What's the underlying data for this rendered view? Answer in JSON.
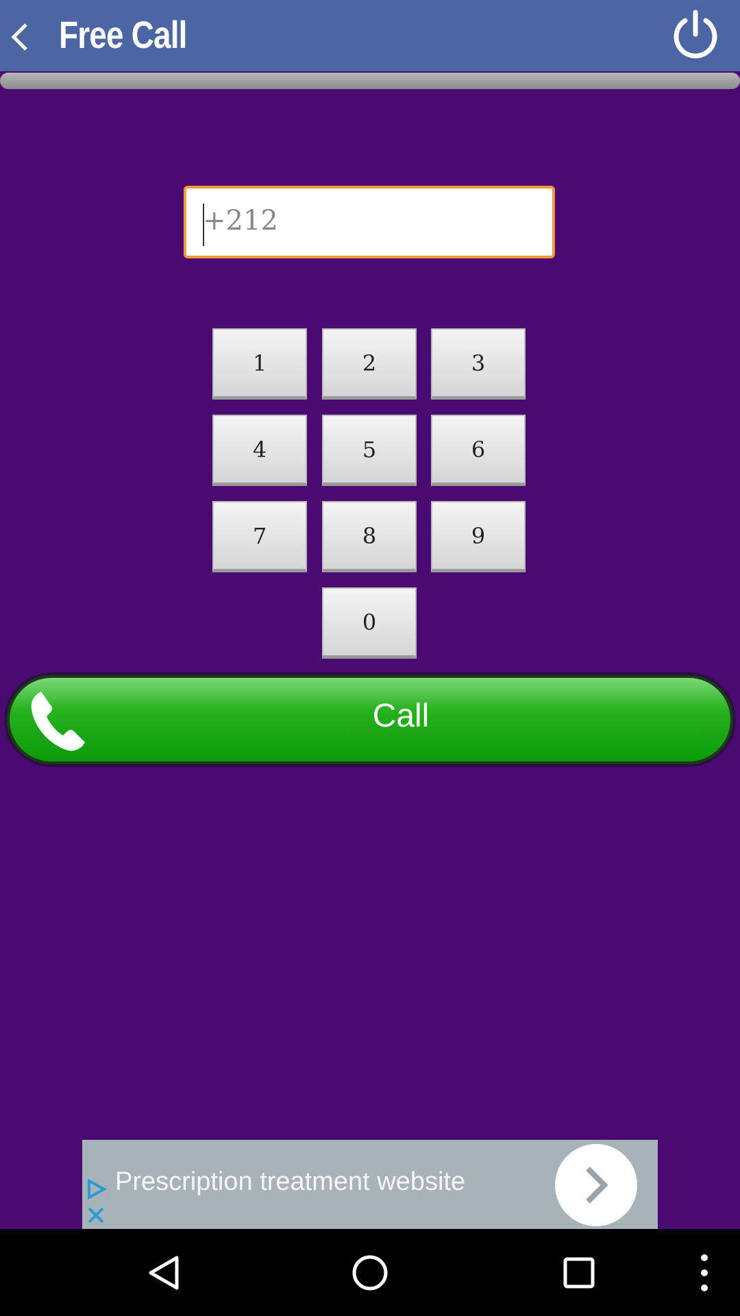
{
  "app_bar": {
    "title": "Free Call",
    "back_icon": "chevron-left-icon",
    "power_icon": "power-icon",
    "background": "#4b66a2"
  },
  "dialer": {
    "number_value": "+212",
    "keys": [
      "1",
      "2",
      "3",
      "4",
      "5",
      "6",
      "7",
      "8",
      "9",
      "0"
    ],
    "field_border_color": "#f29a3a"
  },
  "call_button": {
    "label": "Call",
    "icon": "phone-handset-icon",
    "color": "#0a9a0a"
  },
  "ad": {
    "text": "Prescription treatment website",
    "play_icon": "ad-choices-icon",
    "close_icon": "close-icon",
    "arrow_icon": "chevron-right-icon"
  },
  "nav_bar": {
    "buttons": [
      "back-triangle-icon",
      "home-circle-icon",
      "recents-square-icon",
      "more-vert-icon"
    ]
  },
  "colors": {
    "page_background": "#4a0a72"
  }
}
